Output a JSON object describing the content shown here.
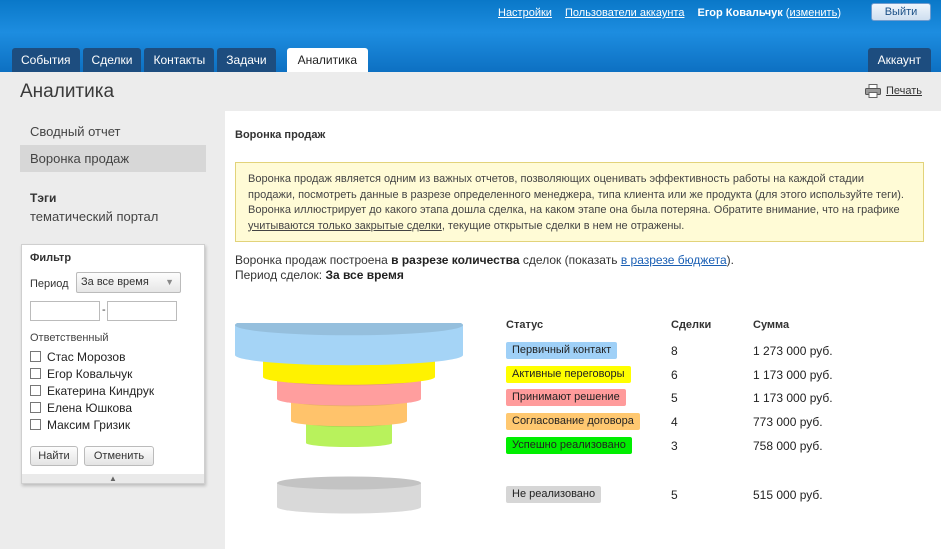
{
  "header": {
    "links": {
      "settings": "Настройки",
      "users": "Пользователи аккаунта"
    },
    "user_name": "Егор Ковальчук",
    "change_text": "изменить",
    "logout_label": "Выйти"
  },
  "tabs": [
    {
      "label": "События"
    },
    {
      "label": "Сделки"
    },
    {
      "label": "Контакты"
    },
    {
      "label": "Задачи"
    },
    {
      "label": "Аналитика",
      "active": true
    }
  ],
  "account_tab": "Аккаунт",
  "page": {
    "title": "Аналитика",
    "print_label": "Печать"
  },
  "sidebar": {
    "items": [
      {
        "label": "Сводный отчет"
      },
      {
        "label": "Воронка продаж",
        "active": true
      }
    ],
    "tags_title": "Тэги",
    "tag": "тематический портал"
  },
  "filter": {
    "title": "Фильтр",
    "period_label": "Период",
    "period_value": "За все время",
    "date_from": "",
    "date_to": "",
    "responsible_label": "Ответственный",
    "users": [
      "Стас Морозов",
      "Егор Ковальчук",
      "Екатерина Киндрук",
      "Елена Юшкова",
      "Максим Гризик"
    ],
    "apply_label": "Найти",
    "reset_label": "Отменить"
  },
  "main": {
    "section_title": "Воронка продаж",
    "note_part1": "Воронка продаж является одним из важных отчетов, позволяющих оценивать эффективность работы на каждой стадии продажи, посмотреть данные в разрезе определенного менеджера, типа клиента или же продукта (для этого используйте теги). Воронка иллюстрирует до какого этапа дошла сделка, на каком этапе она была потеряна. Обратите внимание, что на графике ",
    "note_link": "учитываются только закрытые сделки",
    "note_part2": ", текущие открытые сделки в нем не отражены.",
    "build_prefix": "Воронка продаж построена ",
    "build_bold": "в разрезе количества",
    "build_mid": " сделок (показать ",
    "build_link": "в разрезе бюджета",
    "build_suffix": ").",
    "period_prefix": "Период сделок: ",
    "period_value": "За все время"
  },
  "table": {
    "headers": {
      "status": "Статус",
      "deals": "Сделки",
      "sum": "Сумма"
    },
    "rows": [
      {
        "status": "Первичный контакт",
        "deals": "8",
        "sum": "1 273 000 руб.",
        "color": "#9fd0f7"
      },
      {
        "status": "Активные переговоры",
        "deals": "6",
        "sum": "1 173 000 руб.",
        "color": "#ffff00"
      },
      {
        "status": "Принимают решение",
        "deals": "5",
        "sum": "1 173 000 руб.",
        "color": "#ff9b9b"
      },
      {
        "status": "Согласование договора",
        "deals": "4",
        "sum": "773 000 руб.",
        "color": "#ffc870"
      },
      {
        "status": "Успешно реализовано",
        "deals": "3",
        "sum": "758 000 руб.",
        "color": "#00ee00"
      }
    ],
    "lost": {
      "status": "Не реализовано",
      "deals": "5",
      "sum": "515 000 руб.",
      "color": "#d6d6d6"
    }
  },
  "funnel_colors": [
    "#a5d4f6",
    "#fff200",
    "#ff9e9e",
    "#ffc36b",
    "#b8f25c"
  ],
  "lost_color": "#d9d9d9"
}
